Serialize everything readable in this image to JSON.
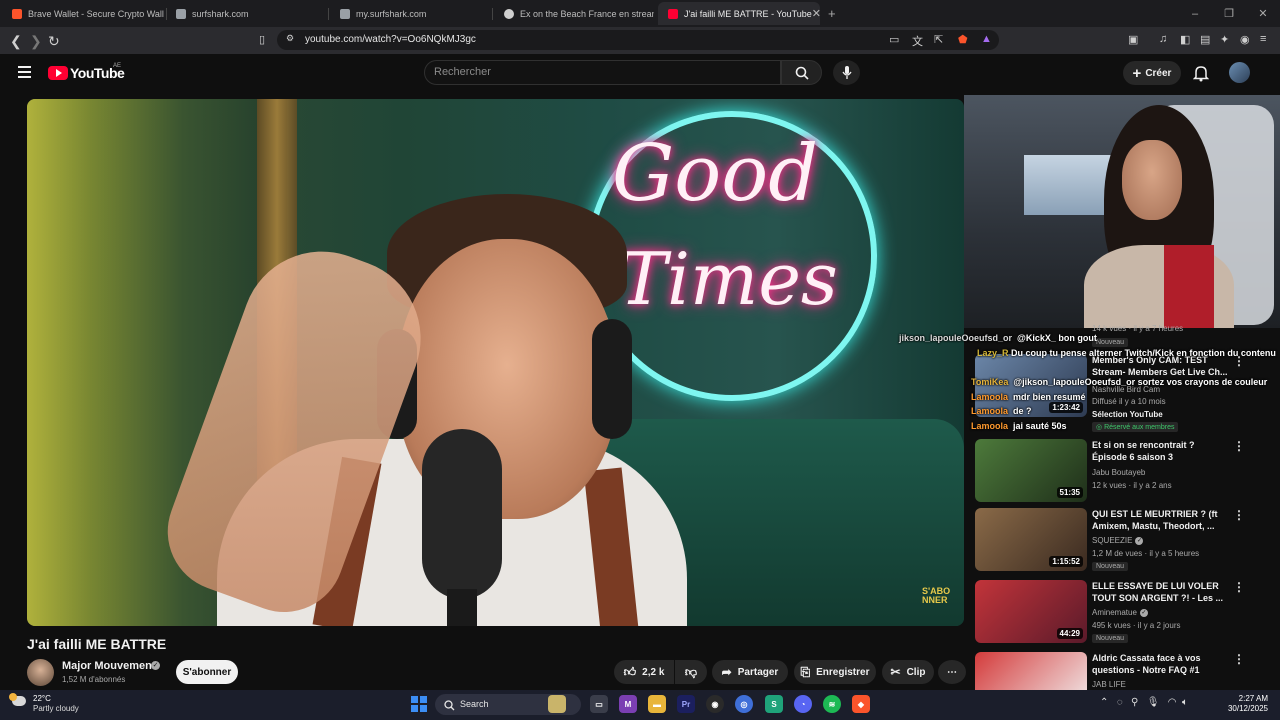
{
  "browser": {
    "tabs": [
      {
        "title": "Brave Wallet - Secure Crypto Wallet |",
        "active": false,
        "icon_color": "#fb542b"
      },
      {
        "title": "surfshark.com",
        "active": false,
        "icon_color": "#9aa0a6"
      },
      {
        "title": "my.surfshark.com",
        "active": false,
        "icon_color": "#9aa0a6"
      },
      {
        "title": "Ex on the Beach France en streaming",
        "active": false,
        "icon_color": "#cfcfcf"
      },
      {
        "title": "J'ai failli ME BATTRE - YouTube",
        "active": true,
        "icon_color": "#ff0033"
      }
    ],
    "new_tab": "+",
    "url": "youtube.com/watch?v=Oo6NQkMJ3gc"
  },
  "youtube": {
    "logo_text": "YouTube",
    "country": "AE",
    "search_placeholder": "Rechercher",
    "create_label": "Créer"
  },
  "video": {
    "neon_line1": "Good",
    "neon_line2": "Times",
    "watermark_line1": "S'ABO",
    "watermark_line2": "NNER",
    "title": "J'ai failli ME BATTRE",
    "channel": "Major Mouvement",
    "subscribers": "1,52 M d'abonnés",
    "subscribe_label": "S'abonner",
    "likes": "2,2 k",
    "share_label": "Partager",
    "save_label": "Enregistrer",
    "clip_label": "Clip"
  },
  "recommendations": [
    {
      "title": "Member's Only CAM: TEST Stream- Members Get Live Ch...",
      "channel": "Nashville Bird Cam",
      "meta": "Diffusé il y a 10 mois",
      "extra": "Sélection YouTube",
      "badge": "Réservé aux membres",
      "duration": "1:23:42",
      "colors": [
        "#6b86a8",
        "#2e3b52"
      ]
    },
    {
      "title": "Et si on se rencontrait ? Épisode 6 saison 3",
      "channel": "Jabu Boutayeb",
      "meta": "12 k vues · il y a 2 ans",
      "duration": "51:35",
      "colors": [
        "#4d7a3b",
        "#1f2f1a"
      ]
    },
    {
      "title": "QUI EST LE MEURTRIER ? (ft Amixem, Mastu, Theodort, ...",
      "channel": "SQUEEZIE",
      "meta": "1,2 M de vues · il y a 5 heures",
      "badge": "Nouveau",
      "duration": "1:15:52",
      "colors": [
        "#8a6a48",
        "#3a2a20"
      ]
    },
    {
      "title": "ELLE ESSAYE DE LUI VOLER TOUT SON ARGENT ?! - Les ...",
      "channel": "Aminematue",
      "meta": "495 k vues · il y a 2 jours",
      "badge": "Nouveau",
      "duration": "44:29",
      "colors": [
        "#c2343a",
        "#5a1a2a"
      ]
    },
    {
      "title": "Aldric Cassata face à vos questions - Notre FAQ #1",
      "channel": "JAB LIFE",
      "colors": [
        "#d43b3b",
        "#f2f2f2"
      ]
    }
  ],
  "partial_rec": {
    "meta": "14 k vues · il y a 7 heures",
    "badge": "Nouveau"
  },
  "chat": [
    {
      "user": "jikson_lapouleOoeufsd_or",
      "text": "@KickX_ bon gout",
      "color": "#d9d9d9"
    },
    {
      "user": "Lazy_R",
      "text": "Du coup tu pense alterner Twitch/Kick en fonction du contenu",
      "color": "#d5b83a"
    },
    {
      "user": "TomiKea",
      "text": "@jikson_lapouleOoeufsd_or sortez vos crayons de couleur",
      "color": "#e3b23a"
    },
    {
      "user": "Lamoola",
      "text": "mdr bien resumé",
      "color": "#ff9a2e"
    },
    {
      "user": "Lamoola",
      "text": "de ?",
      "color": "#ff9a2e"
    },
    {
      "user": "Lamoola",
      "text": "jai sauté 50s",
      "color": "#ff9a2e"
    }
  ],
  "taskbar": {
    "temperature": "22°C",
    "weather": "Partly cloudy",
    "search_label": "Search",
    "time": "2:27 AM",
    "date": "30/12/2025"
  }
}
